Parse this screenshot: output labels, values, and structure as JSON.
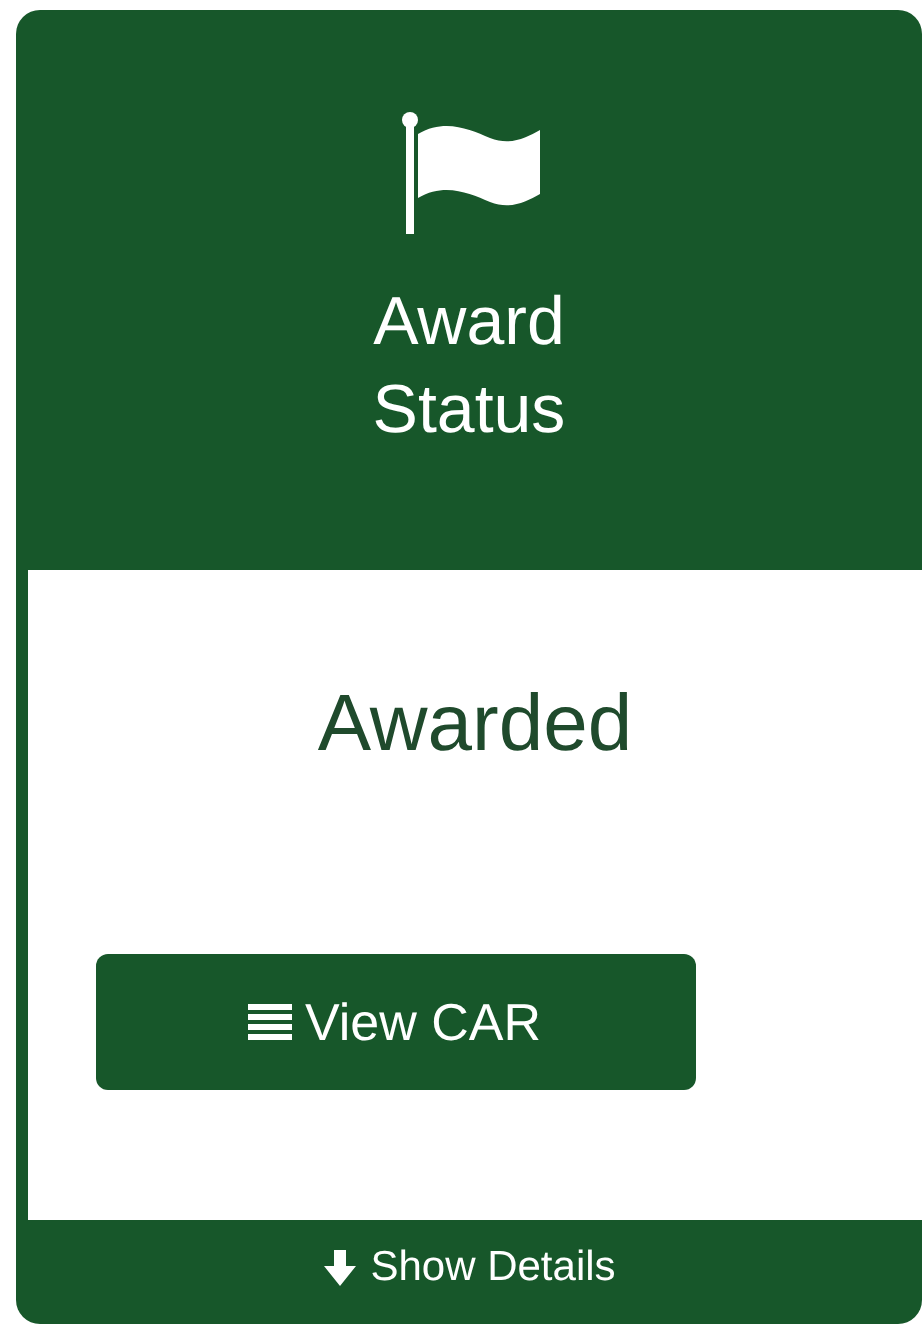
{
  "card": {
    "title": "Award Status",
    "status": "Awarded",
    "button": "View CAR",
    "footer_link": "Show Details"
  }
}
